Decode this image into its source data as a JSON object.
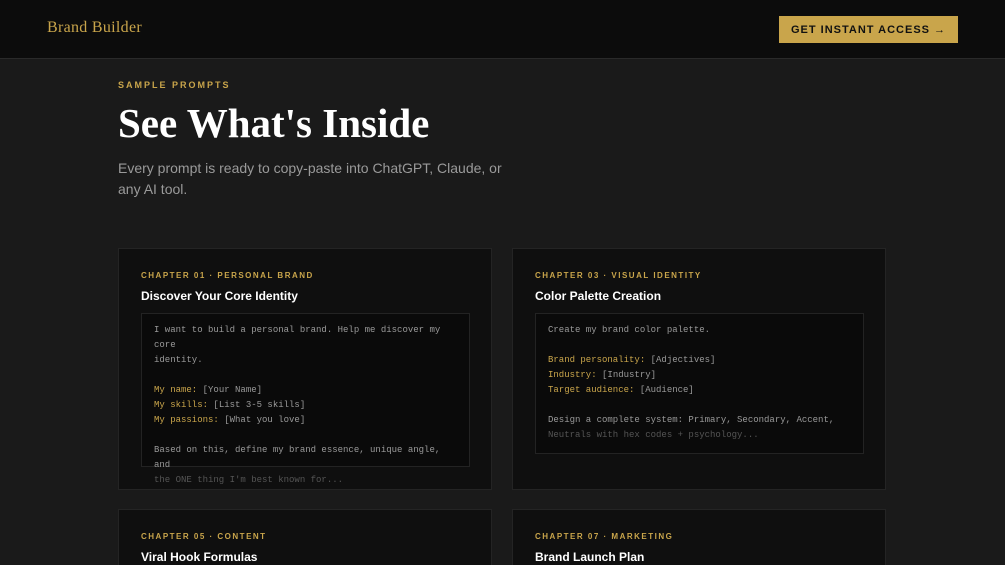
{
  "header": {
    "brand": "Brand Builder",
    "cta_label": "GET INSTANT ACCESS",
    "cta_arrow": "→"
  },
  "hero": {
    "eyebrow": "SAMPLE PROMPTS",
    "title": "See What's Inside",
    "subtitle": "Every prompt is ready to copy-paste into ChatGPT, Claude, or any AI tool."
  },
  "cards": [
    {
      "label": "CHAPTER 01 · PERSONAL BRAND",
      "title": "Discover Your Core Identity",
      "intro_1": "I want to build a personal brand. Help me discover my core",
      "intro_2": "identity.",
      "fields": [
        {
          "key": "My name:",
          "value": "[Your Name]"
        },
        {
          "key": "My skills:",
          "value": "[List 3-5 skills]"
        },
        {
          "key": "My passions:",
          "value": "[What you love]"
        }
      ],
      "outro_1": "Based on this, define my brand essence, unique angle, and",
      "outro_2": "the ONE thing I'm best known for..."
    },
    {
      "label": "CHAPTER 03 · VISUAL IDENTITY",
      "title": "Color Palette Creation",
      "intro_1": "Create my brand color palette.",
      "fields": [
        {
          "key": "Brand personality:",
          "value": "[Adjectives]"
        },
        {
          "key": "Industry:",
          "value": "[Industry]"
        },
        {
          "key": "Target audience:",
          "value": "[Audience]"
        }
      ],
      "outro_1": "Design a complete system: Primary, Secondary, Accent,",
      "outro_2": "Neutrals with hex codes + psychology..."
    },
    {
      "label": "CHAPTER 05 · CONTENT",
      "title": "Viral Hook Formulas"
    },
    {
      "label": "CHAPTER 07 · MARKETING",
      "title": "Brand Launch Plan"
    }
  ],
  "colors": {
    "accent": "#c9a54b",
    "background": "#1a1a1a",
    "card": "#0f0f0f"
  }
}
